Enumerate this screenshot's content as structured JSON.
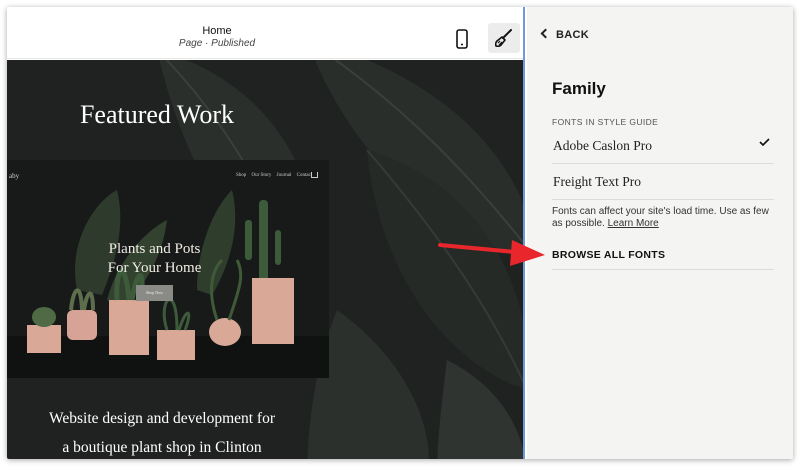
{
  "editor": {
    "page_title": "Home",
    "page_status": "Page · Published",
    "mobile_icon": "phone-icon",
    "style_icon": "paintbrush-icon"
  },
  "canvas": {
    "heading": "Featured Work",
    "mockup": {
      "logo": "aby",
      "nav": [
        "Shop",
        "Our Story",
        "Journal",
        "Contact"
      ],
      "headline_line1": "Plants and Pots",
      "headline_line2": "For Your Home",
      "button": "Shop Now"
    },
    "caption_line1": "Website design and development for",
    "caption_line2": "a boutique plant shop in Clinton"
  },
  "panel": {
    "back_label": "BACK",
    "title": "Family",
    "section_label": "FONTS IN STYLE GUIDE",
    "fonts": [
      {
        "name": "Adobe Caslon Pro",
        "selected": true
      },
      {
        "name": "Freight Text Pro",
        "selected": false
      }
    ],
    "note": "Fonts can affect your site's load time. Use as few as possible.",
    "learn_more": "Learn More",
    "browse_all": "BROWSE ALL FONTS"
  },
  "colors": {
    "annotation_arrow": "#e8262b",
    "canvas_bg": "#1f2220",
    "panel_bg": "#f4f4f3",
    "selection_border": "#6d9bd8"
  }
}
